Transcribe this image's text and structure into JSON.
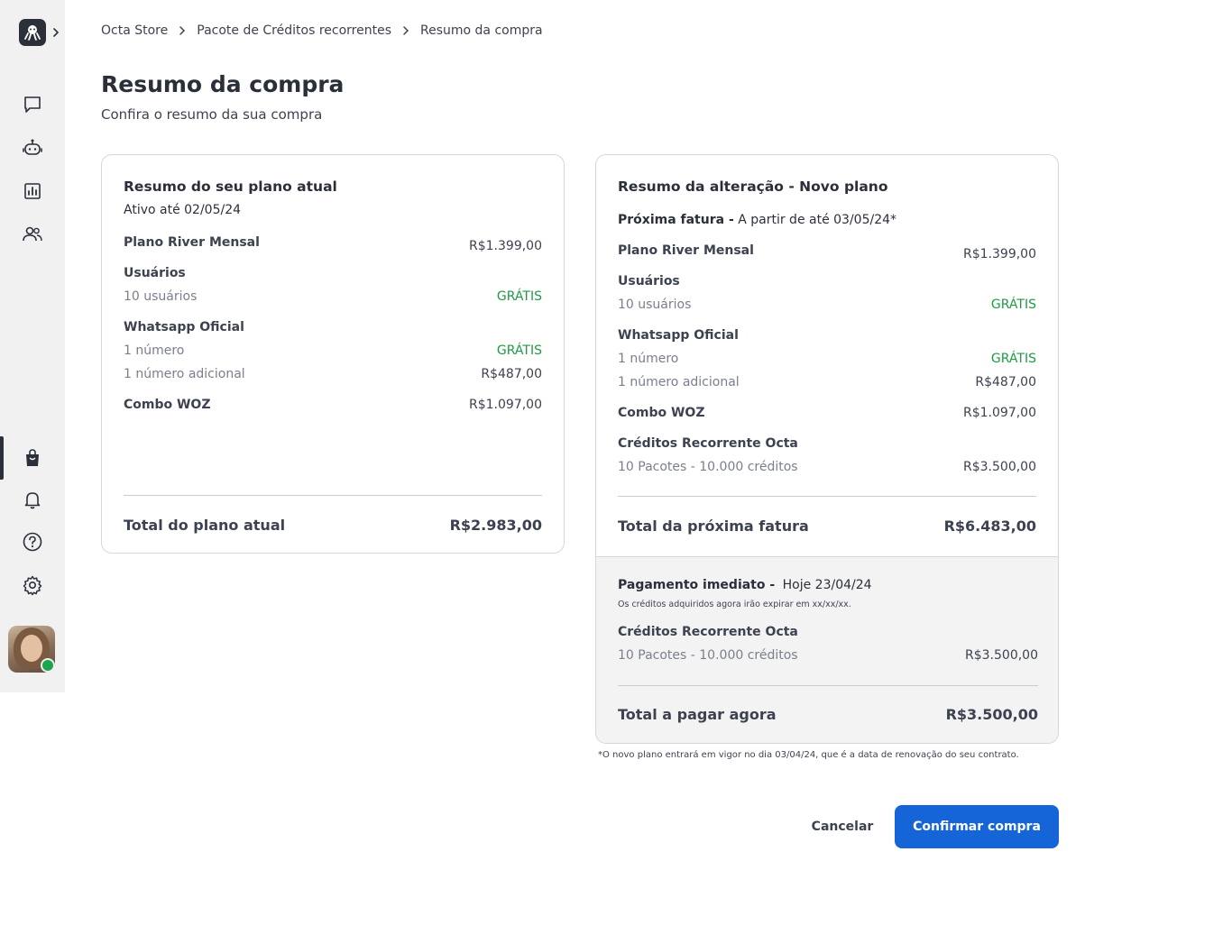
{
  "breadcrumb": {
    "items": [
      "Octa Store",
      "Pacote de Créditos recorrentes",
      "Resumo da compra"
    ]
  },
  "page": {
    "title": "Resumo da compra",
    "subtitle": "Confira o resumo da sua compra"
  },
  "current_plan": {
    "title": "Resumo do seu plano atual",
    "active_until": "Ativo até 02/05/24",
    "plan_label": "Plano River Mensal",
    "plan_price": "R$1.399,00",
    "users_label": "Usuários",
    "users_detail": "10 usuários",
    "users_price": "GRÁTIS",
    "whatsapp_label": "Whatsapp Oficial",
    "whatsapp_number": "1 número",
    "whatsapp_number_price": "GRÁTIS",
    "whatsapp_additional": "1 número adicional",
    "whatsapp_additional_price": "R$487,00",
    "combo_label": "Combo WOZ",
    "combo_price": "R$1.097,00",
    "total_label": "Total do plano atual",
    "total_value": "R$2.983,00"
  },
  "new_plan": {
    "title": "Resumo da alteração - Novo plano",
    "next_invoice_label": "Próxima fatura -",
    "next_invoice_date": "A partir de até 03/05/24*",
    "plan_label": "Plano River Mensal",
    "plan_price": "R$1.399,00",
    "users_label": "Usuários",
    "users_detail": "10 usuários",
    "users_price": "GRÁTIS",
    "whatsapp_label": "Whatsapp Oficial",
    "whatsapp_number": "1 número",
    "whatsapp_number_price": "GRÁTIS",
    "whatsapp_additional": "1 número adicional",
    "whatsapp_additional_price": "R$487,00",
    "combo_label": "Combo WOZ",
    "combo_price": "R$1.097,00",
    "credits_label": "Créditos Recorrente Octa",
    "credits_detail": "10 Pacotes - 10.000 créditos",
    "credits_price": "R$3.500,00",
    "total_label": "Total da próxima fatura",
    "total_value": "R$6.483,00"
  },
  "immediate_payment": {
    "label": "Pagamento imediato -",
    "date": "Hoje 23/04/24",
    "note": "Os créditos adquiridos agora irão expirar em xx/xx/xx.",
    "credits_label": "Créditos Recorrente Octa",
    "credits_detail": "10 Pacotes - 10.000 créditos",
    "credits_price": "R$3.500,00",
    "total_label": "Total a pagar agora",
    "total_value": "R$3.500,00"
  },
  "footnote": "*O novo plano entrará em vigor no dia 03/04/24, que é a data de renovação do seu contrato.",
  "actions": {
    "cancel": "Cancelar",
    "confirm": "Confirmar compra"
  },
  "sidebar": {
    "icons": [
      "octopus-logo-icon",
      "chevron-right-icon",
      "chat-icon",
      "bot-icon",
      "chart-icon",
      "users-icon",
      "shopping-bag-icon",
      "bell-icon",
      "help-icon",
      "gear-icon"
    ],
    "active_item": "shopping-bag-icon"
  },
  "colors": {
    "primary": "#1565d8",
    "free": "#1e9a45",
    "text": "#2b2f3a",
    "sidebar_bg": "#f1f1f2",
    "status_online": "#1ea44a"
  }
}
